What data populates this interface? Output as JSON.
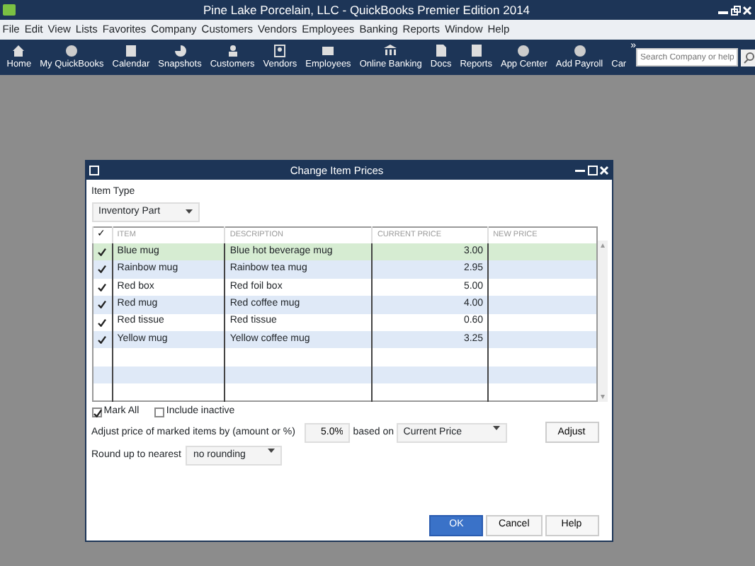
{
  "window": {
    "title": "Pine Lake Porcelain, LLC  - QuickBooks Premier Edition 2014"
  },
  "menu": [
    "File",
    "Edit",
    "View",
    "Lists",
    "Favorites",
    "Company",
    "Customers",
    "Vendors",
    "Employees",
    "Banking",
    "Reports",
    "Window",
    "Help"
  ],
  "toolbar": [
    "Home",
    "My QuickBooks",
    "Calendar",
    "Snapshots",
    "Customers",
    "Vendors",
    "Employees",
    "Online Banking",
    "Docs",
    "Reports",
    "App Center",
    "Add Payroll",
    "Car"
  ],
  "toolbar_more": "»",
  "search": {
    "placeholder": "Search Company or help"
  },
  "dialog": {
    "title": "Change Item Prices",
    "item_type_label": "Item Type",
    "item_type": "Inventory Part",
    "columns": [
      "✓",
      "ITEM",
      "DESCRIPTION",
      "CURRENT PRICE",
      "NEW PRICE"
    ],
    "rows": [
      {
        "checked": true,
        "selected": true,
        "item": "Blue mug",
        "description": "Blue hot beverage mug",
        "current_price": "3.00"
      },
      {
        "checked": true,
        "selected": false,
        "item": "Rainbow mug",
        "description": "Rainbow tea mug",
        "current_price": "2.95"
      },
      {
        "checked": true,
        "selected": false,
        "item": "Red box",
        "description": "Red foil box",
        "current_price": "5.00"
      },
      {
        "checked": true,
        "selected": false,
        "item": "Red mug",
        "description": "Red coffee mug",
        "current_price": "4.00"
      },
      {
        "checked": true,
        "selected": false,
        "item": "Red tissue",
        "description": "Red tissue",
        "current_price": "0.60"
      },
      {
        "checked": true,
        "selected": false,
        "item": "Yellow mug",
        "description": "Yellow coffee mug",
        "current_price": "3.25"
      }
    ],
    "mark_all": {
      "label": "Mark All",
      "checked": true
    },
    "include_inactive": {
      "label": "Include inactive",
      "checked": false
    },
    "adjust_label": "Adjust price of marked items by (amount or %)",
    "adjust_value": "5.0%",
    "based_on_label": "based on",
    "based_on": "Current Price",
    "adjust_button": "Adjust",
    "round_label": "Round up to nearest",
    "round": "no rounding",
    "buttons": [
      {
        "label": "OK",
        "primary": true
      },
      {
        "label": "Cancel",
        "primary": false
      },
      {
        "label": "Help",
        "primary": false
      }
    ]
  }
}
